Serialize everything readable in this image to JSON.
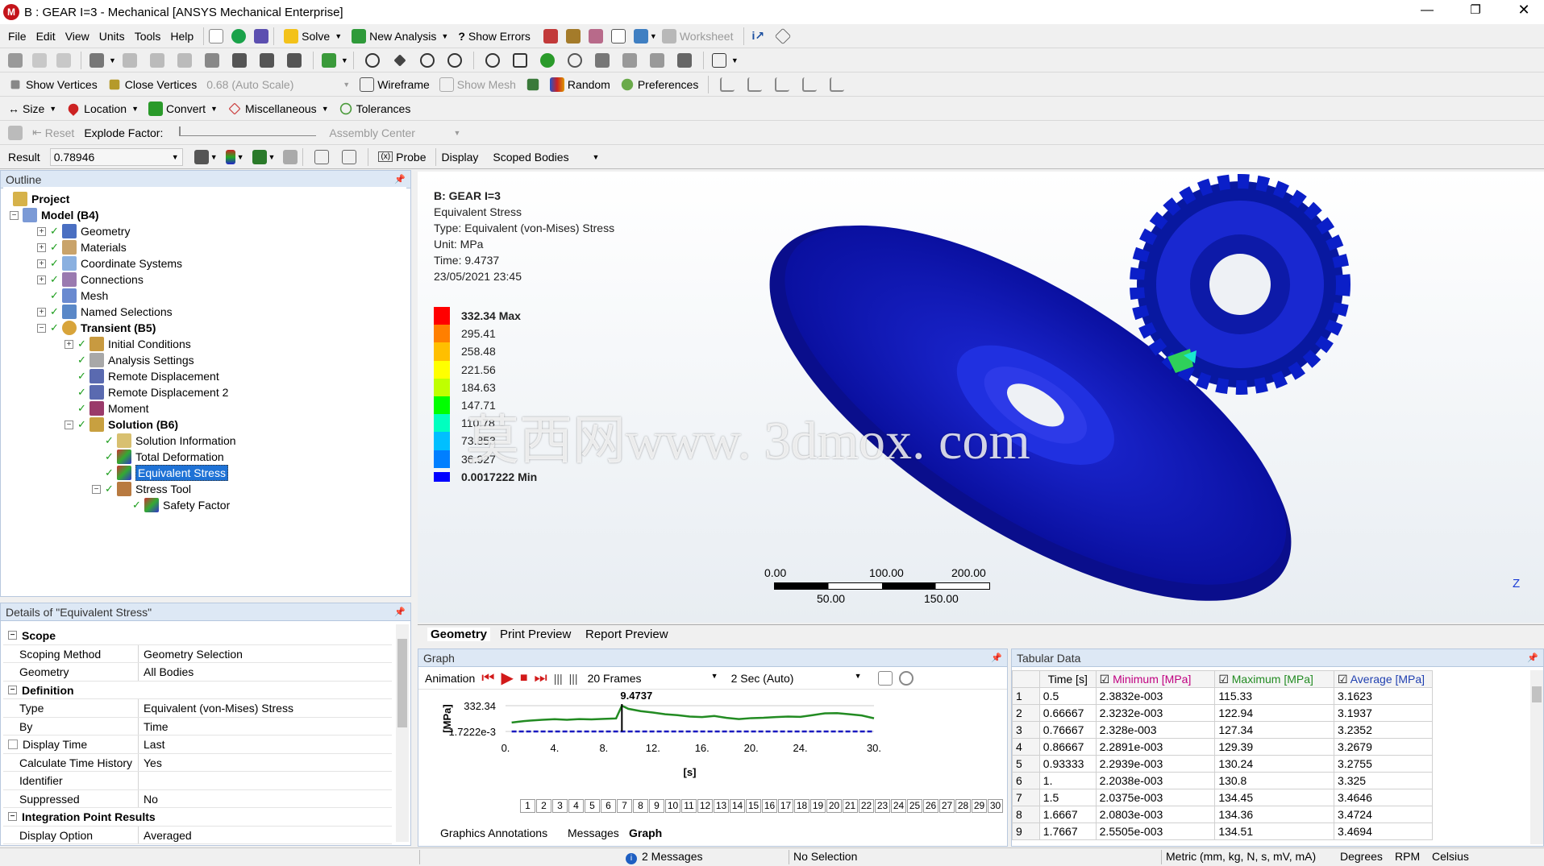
{
  "window": {
    "title": "B : GEAR I=3 - Mechanical [ANSYS Mechanical Enterprise]"
  },
  "menu": [
    "File",
    "Edit",
    "View",
    "Units",
    "Tools",
    "Help"
  ],
  "toolbar1": {
    "solve": "Solve",
    "new_analysis": "New Analysis",
    "show_errors": "Show Errors",
    "worksheet": "Worksheet"
  },
  "toolbar3": {
    "show_vertices": "Show Vertices",
    "close_vertices": "Close Vertices",
    "auto_scale": "0.68 (Auto Scale)",
    "wireframe": "Wireframe",
    "show_mesh": "Show Mesh",
    "random": "Random",
    "preferences": "Preferences"
  },
  "toolbar4": {
    "size": "Size",
    "location": "Location",
    "convert": "Convert",
    "misc": "Miscellaneous",
    "tolerances": "Tolerances"
  },
  "toolbar5": {
    "reset": "Reset",
    "explode_factor": "Explode Factor:",
    "assembly_center": "Assembly Center"
  },
  "toolbar6": {
    "result_label": "Result",
    "result_value": "0.78946",
    "probe": "Probe",
    "display_label": "Display",
    "display_value": "Scoped Bodies"
  },
  "outline": {
    "header": "Outline",
    "items": [
      {
        "label": "Project",
        "bold": true
      },
      {
        "label": "Model (B4)",
        "bold": true
      },
      {
        "label": "Geometry"
      },
      {
        "label": "Materials"
      },
      {
        "label": "Coordinate Systems"
      },
      {
        "label": "Connections"
      },
      {
        "label": "Mesh"
      },
      {
        "label": "Named Selections"
      },
      {
        "label": "Transient (B5)",
        "bold": true
      },
      {
        "label": "Initial Conditions"
      },
      {
        "label": "Analysis Settings"
      },
      {
        "label": "Remote Displacement"
      },
      {
        "label": "Remote Displacement 2"
      },
      {
        "label": "Moment"
      },
      {
        "label": "Solution (B6)",
        "bold": true
      },
      {
        "label": "Solution Information"
      },
      {
        "label": "Total Deformation"
      },
      {
        "label": "Equivalent Stress",
        "selected": true
      },
      {
        "label": "Stress Tool"
      },
      {
        "label": "Safety Factor"
      }
    ]
  },
  "details": {
    "header": "Details of \"Equivalent Stress\"",
    "scope": "Scope",
    "scoping_method": {
      "k": "Scoping Method",
      "v": "Geometry Selection"
    },
    "geometry": {
      "k": "Geometry",
      "v": "All Bodies"
    },
    "definition": "Definition",
    "type": {
      "k": "Type",
      "v": "Equivalent (von-Mises) Stress"
    },
    "by": {
      "k": "By",
      "v": "Time"
    },
    "display_time": {
      "k": "Display Time",
      "v": "Last"
    },
    "calc_history": {
      "k": "Calculate Time History",
      "v": "Yes"
    },
    "identifier": {
      "k": "Identifier",
      "v": ""
    },
    "suppressed": {
      "k": "Suppressed",
      "v": "No"
    },
    "integration": "Integration Point Results",
    "display_option": {
      "k": "Display Option",
      "v": "Averaged"
    }
  },
  "viewport": {
    "info": [
      "B: GEAR I=3",
      "Equivalent Stress",
      "Type: Equivalent (von-Mises) Stress",
      "Unit: MPa",
      "Time: 9.4737",
      "23/05/2021 23:45"
    ],
    "legend": [
      "332.34 Max",
      "295.41",
      "258.48",
      "221.56",
      "184.63",
      "147.71",
      "110.78",
      "73.853",
      "36.927",
      "0.0017222 Min"
    ],
    "legend_colors": [
      "#ff0000",
      "#ff7f00",
      "#ffbf00",
      "#ffff00",
      "#bfff00",
      "#00ff00",
      "#00ffbf",
      "#00bfff",
      "#007fff",
      "#0000ff"
    ],
    "watermark": "莫西网www. 3dmox. com",
    "scale_top": [
      "0.00",
      "100.00",
      "200.00"
    ],
    "scale_bottom": [
      "50.00",
      "150.00"
    ],
    "axis_z": "Z"
  },
  "view_tabs": [
    "Geometry",
    "Print Preview",
    "Report Preview"
  ],
  "graph": {
    "header": "Graph",
    "animation": "Animation",
    "frames": "20 Frames",
    "speed": "2 Sec (Auto)",
    "current_time": "9.4737",
    "y_max": "332.34",
    "y_min": "1.7222e-3",
    "y_unit": "[MPa]",
    "x_unit": "[s]",
    "x_ticks": [
      "0.",
      "4.",
      "8.",
      "12.",
      "16.",
      "20.",
      "24.",
      "30."
    ],
    "frame_numbers": [
      "1",
      "2",
      "3",
      "4",
      "5",
      "6",
      "7",
      "8",
      "9",
      "10",
      "11",
      "12",
      "13",
      "14",
      "15",
      "16",
      "17",
      "18",
      "19",
      "20",
      "21",
      "22",
      "23",
      "24",
      "25",
      "26",
      "27",
      "28",
      "29",
      "30"
    ]
  },
  "chart_data": {
    "type": "line",
    "xlabel": "[s]",
    "ylabel": "[MPa]",
    "xlim": [
      0,
      30
    ],
    "ylim": [
      0.0017222,
      332.34
    ],
    "series": [
      {
        "name": "Maximum [MPa]",
        "x": [
          0.5,
          1,
          1.5,
          2,
          3,
          4,
          5,
          6,
          7,
          8,
          9,
          9.4737,
          10,
          11,
          12,
          13,
          14,
          15,
          16,
          17,
          18,
          19,
          20,
          21,
          22,
          23,
          24,
          25,
          26,
          27,
          28,
          29,
          30
        ],
        "values": [
          115,
          125,
          134,
          140,
          150,
          158,
          150,
          160,
          156,
          162,
          168,
          332.34,
          292,
          262,
          244,
          222,
          210,
          192,
          186,
          200,
          175,
          160,
          172,
          176,
          186,
          192,
          188,
          210,
          234,
          236,
          222,
          206,
          170
        ]
      },
      {
        "name": "Minimum [MPa]",
        "x": [
          0.5,
          30
        ],
        "values": [
          0.0024,
          0.0024
        ]
      }
    ]
  },
  "bottom_tabs": [
    "Graphics Annotations",
    "Messages",
    "Graph"
  ],
  "tabular": {
    "header": "Tabular Data",
    "columns": [
      "Time [s]",
      "Minimum [MPa]",
      "Maximum [MPa]",
      "Average [MPa]"
    ],
    "rows": [
      [
        "1",
        "0.5",
        "2.3832e-003",
        "115.33",
        "3.1623"
      ],
      [
        "2",
        "0.66667",
        "2.3232e-003",
        "122.94",
        "3.1937"
      ],
      [
        "3",
        "0.76667",
        "2.328e-003",
        "127.34",
        "3.2352"
      ],
      [
        "4",
        "0.86667",
        "2.2891e-003",
        "129.39",
        "3.2679"
      ],
      [
        "5",
        "0.93333",
        "2.2939e-003",
        "130.24",
        "3.2755"
      ],
      [
        "6",
        "1.",
        "2.2038e-003",
        "130.8",
        "3.325"
      ],
      [
        "7",
        "1.5",
        "2.0375e-003",
        "134.45",
        "3.4646"
      ],
      [
        "8",
        "1.6667",
        "2.0803e-003",
        "134.36",
        "3.4724"
      ],
      [
        "9",
        "1.7667",
        "2.5505e-003",
        "134.51",
        "3.4694"
      ]
    ],
    "colors": {
      "minimum": "#c00080",
      "maximum": "#228b22",
      "average": "#1f3fb0"
    }
  },
  "status": {
    "messages": "2 Messages",
    "selection": "No Selection",
    "units": "Metric (mm, kg, N, s, mV, mA)",
    "angle": "Degrees",
    "speed": "RPM",
    "temp": "Celsius"
  }
}
